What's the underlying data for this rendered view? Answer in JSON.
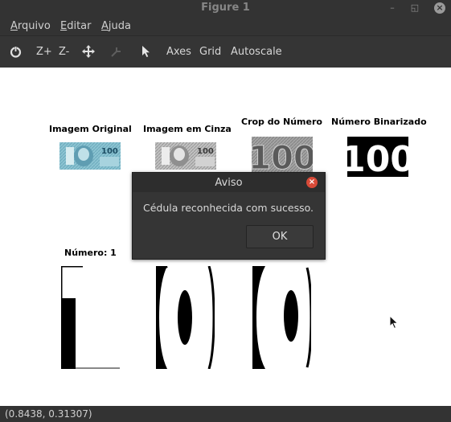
{
  "window": {
    "title": "Figure 1"
  },
  "menu": {
    "items": [
      {
        "underline": "A",
        "rest": "rquivo"
      },
      {
        "underline": "E",
        "rest": "ditar"
      },
      {
        "underline": "A",
        "rest": "juda"
      }
    ]
  },
  "toolbar": {
    "zoom_in": "Z+",
    "zoom_out": "Z-",
    "axes": "Axes",
    "grid": "Grid",
    "autoscale": "Autoscale"
  },
  "plots": {
    "original_title": "Imagem Original",
    "gray_title": "Imagem em Cinza",
    "crop_title": "Crop do Número",
    "binary_title": "Número Binarizado",
    "number_title": "Número: 1",
    "crop_text": "100",
    "binary_text": "100",
    "note_value": "100"
  },
  "dialog": {
    "title": "Aviso",
    "message": "Cédula reconhecida com sucesso.",
    "ok": "OK"
  },
  "status": {
    "coords": "(0.8438, 0.31307)"
  },
  "colors": {
    "dialog_close": "#d84a38",
    "background": "#ffffff",
    "chrome": "#333333"
  },
  "icons": [
    "home-icon",
    "pan-icon",
    "zoom-icon",
    "pointer-icon",
    "close-icon",
    "minimize-icon",
    "maximize-icon"
  ]
}
